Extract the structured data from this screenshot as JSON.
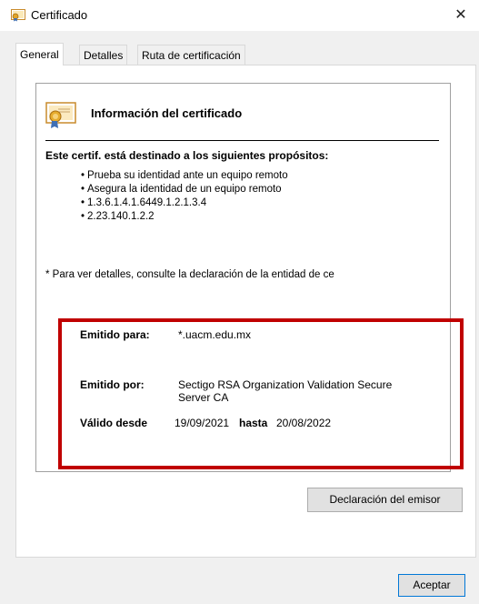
{
  "window": {
    "title": "Certificado",
    "close_glyph": "✕"
  },
  "tabs": [
    {
      "label": "General",
      "active": true
    },
    {
      "label": "Detalles",
      "active": false
    },
    {
      "label": "Ruta de certificación",
      "active": false
    }
  ],
  "info": {
    "title": "Información del certificado",
    "purpose_heading": "Este certif. está destinado a los siguientes propósitos:",
    "purposes": [
      "Prueba su identidad ante un equipo remoto",
      "Asegura la identidad de un equipo remoto",
      "1.3.6.1.4.1.6449.1.2.1.3.4",
      "2.23.140.1.2.2"
    ],
    "footnote": "* Para ver detalles, consulte la declaración de la entidad de ce"
  },
  "details": {
    "issued_to_label": "Emitido para:",
    "issued_to_value": "*.uacm.edu.mx",
    "issued_by_label": "Emitido por:",
    "issued_by_value_line1": "Sectigo RSA Organization Validation Secure",
    "issued_by_value_line2": "Server CA",
    "valid_from_label": "Válido desde",
    "valid_from_value": "19/09/2021",
    "valid_to_label": "hasta",
    "valid_to_value": "20/08/2022"
  },
  "buttons": {
    "issuer_statement": "Declaración del emisor",
    "ok": "Aceptar"
  },
  "icons": {
    "title_icon": "certificate-icon",
    "info_icon": "certificate-icon",
    "close_icon": "close-icon"
  },
  "colors": {
    "highlight_frame": "#c00000",
    "ok_button_border": "#0078d7"
  }
}
